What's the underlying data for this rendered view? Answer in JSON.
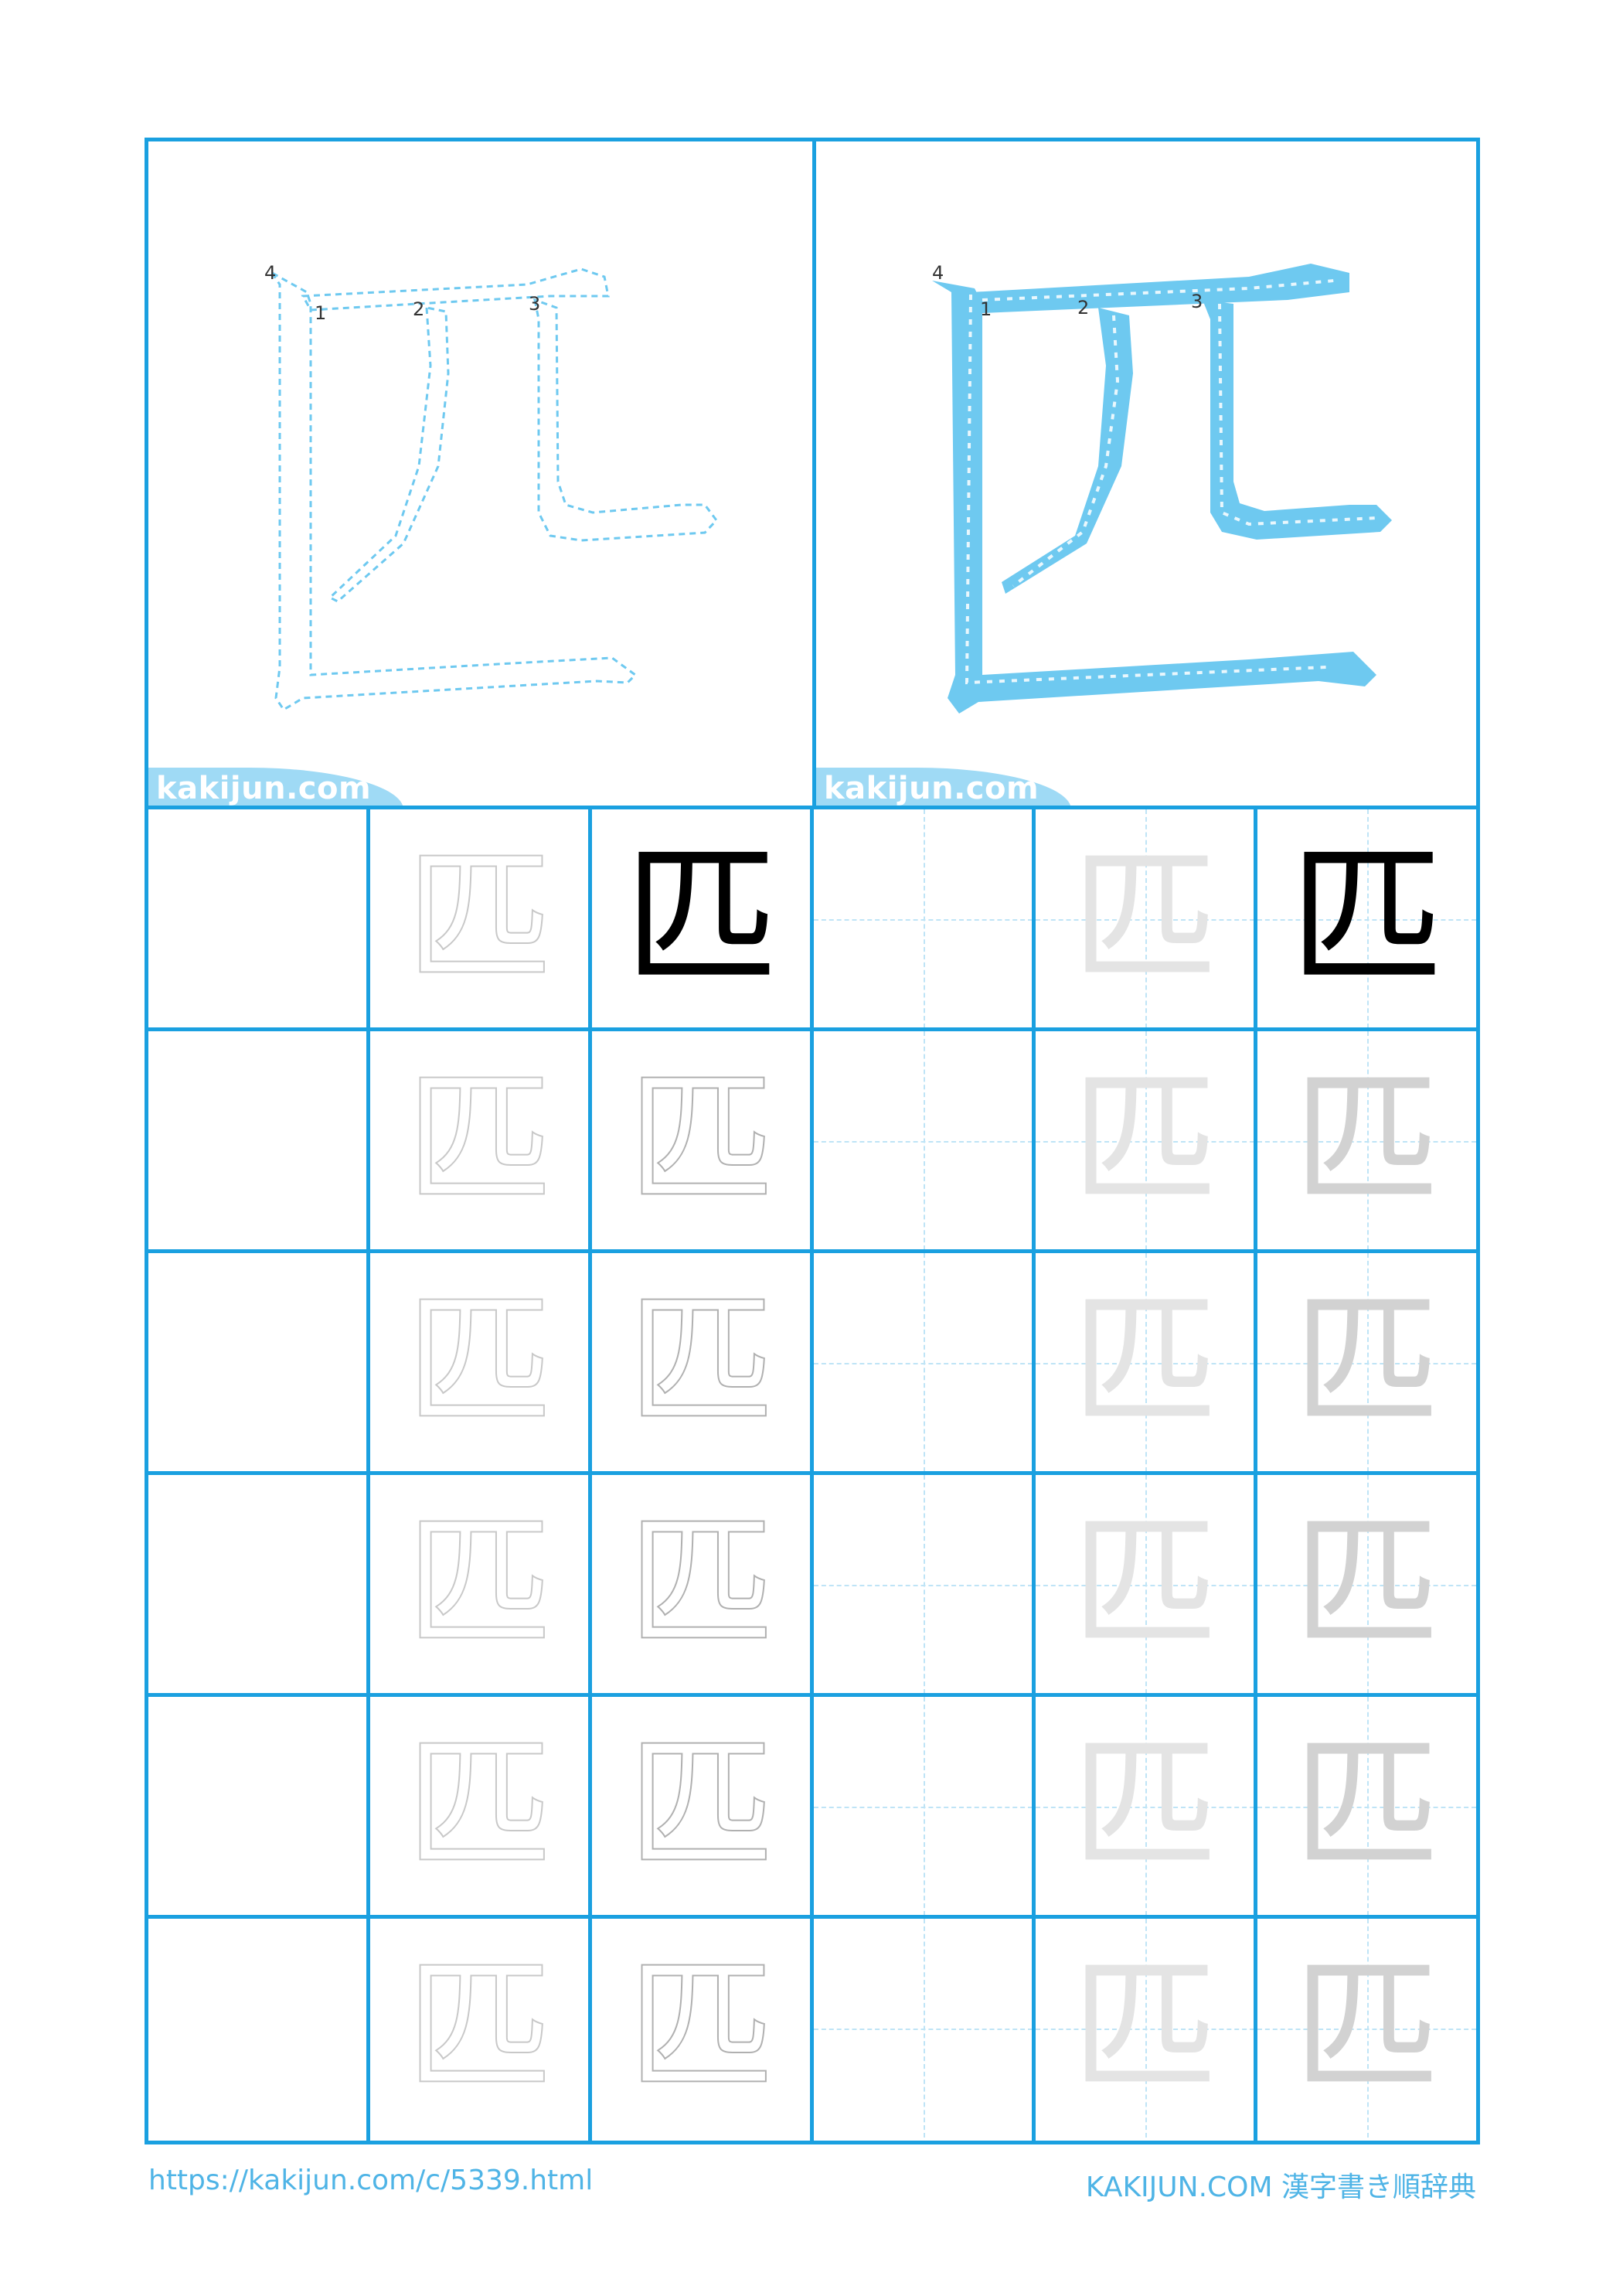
{
  "kanji": "匹",
  "brand": "kakijun.com",
  "stroke_numbers": [
    "1",
    "2",
    "3",
    "4"
  ],
  "footer": {
    "url": "https://kakijun.com/c/5339.html",
    "site": "KAKIJUN.COM 漢字書き順辞典"
  },
  "colors": {
    "accent": "#1aa0e0",
    "stroke_fill": "#6ec9f0"
  }
}
